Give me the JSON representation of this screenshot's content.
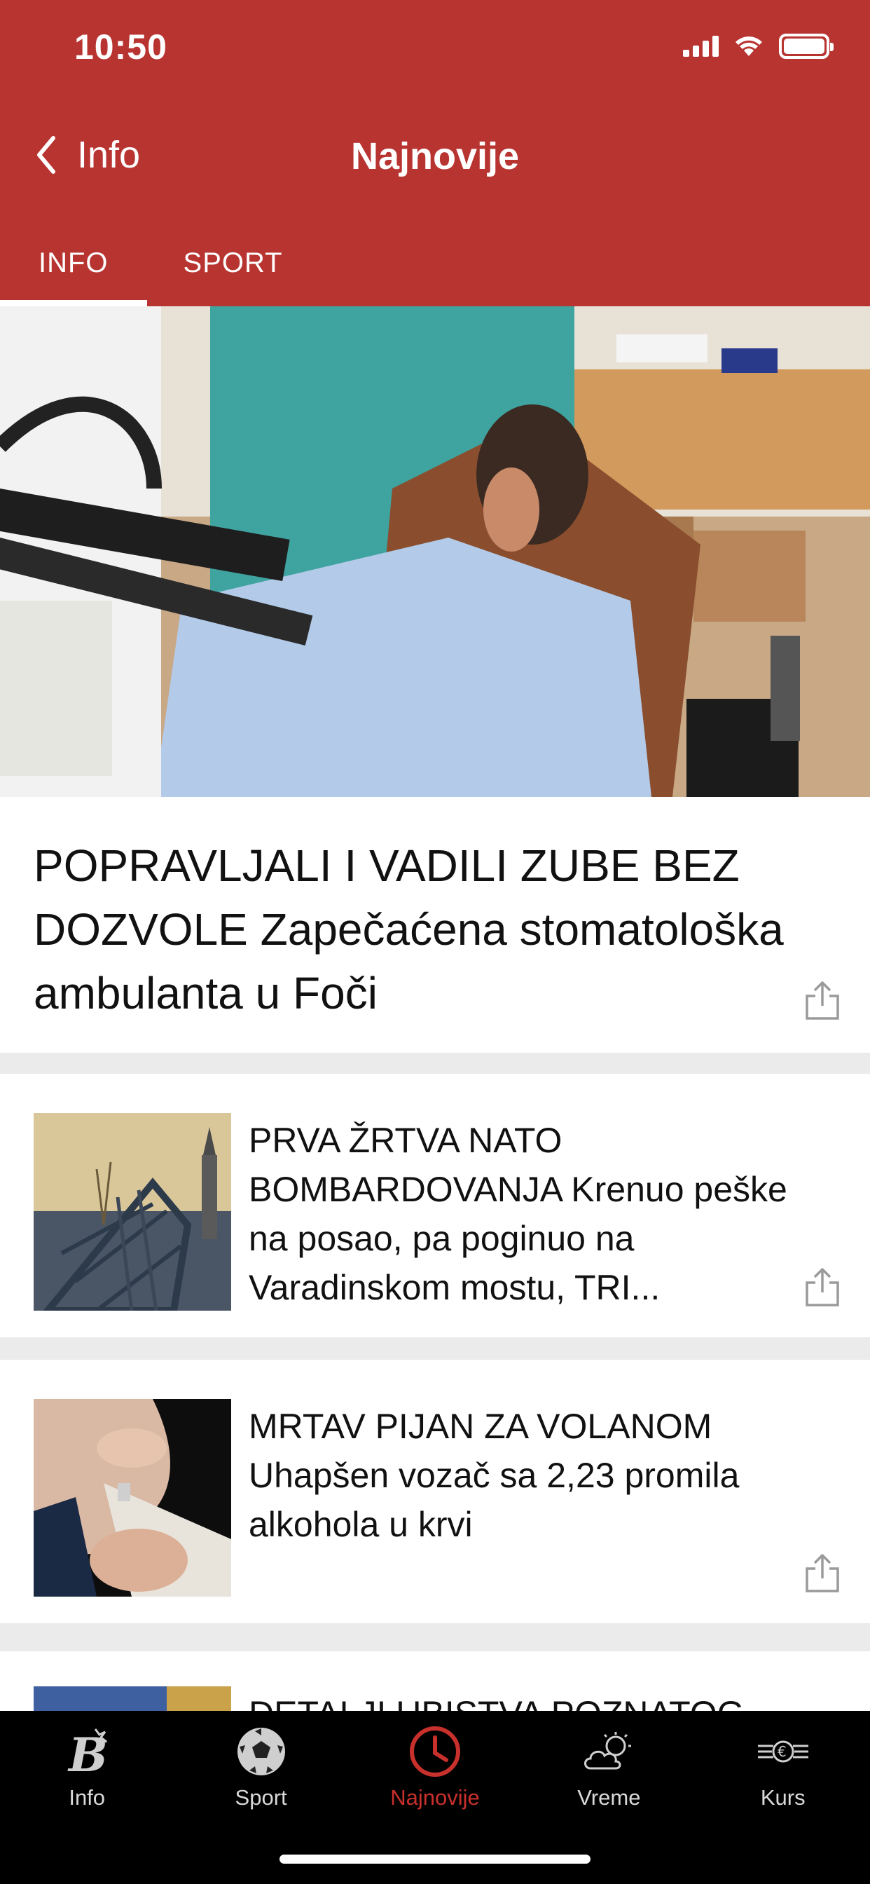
{
  "status_bar": {
    "time": "10:50"
  },
  "nav": {
    "back_label": "Info",
    "title": "Najnovije"
  },
  "tabs": [
    {
      "label": "INFO",
      "active": true
    },
    {
      "label": "SPORT",
      "active": false
    }
  ],
  "hero": {
    "title": "POPRAVLJALI I VADILI ZUBE BEZ DOZVOLE Zapečaćena stomatološka ambulanta u Foči",
    "image": "dentist-treating-patient-photo"
  },
  "articles": [
    {
      "title": "PRVA ŽRTVA NATO BOMBARDOVANJA Krenuo peške na posao, pa poginuo na Varadinskom mostu, TRI...",
      "image": "destroyed-bridge-photo"
    },
    {
      "title": "MRTAV PIJAN ZA VOLANOM Uhapšen vozač sa 2,23 promila alkohola u krvi",
      "image": "breathalyzer-test-photo"
    },
    {
      "title": "DETALJI UBISTVA POZNATOG ... šest metaka i pobegao,",
      "image": "crime-scene-photo"
    }
  ],
  "tabbar": [
    {
      "label": "Info",
      "icon": "b-logo-icon",
      "active": false
    },
    {
      "label": "Sport",
      "icon": "soccer-ball-icon",
      "active": false
    },
    {
      "label": "Najnovije",
      "icon": "clock-icon",
      "active": true
    },
    {
      "label": "Vreme",
      "icon": "weather-cloud-sun-icon",
      "active": false
    },
    {
      "label": "Kurs",
      "icon": "currency-euro-icon",
      "active": false
    }
  ],
  "colors": {
    "header": "#b83431",
    "active_tab": "#c8302c",
    "tabbar_bg": "#000000",
    "divider": "#ebebeb"
  }
}
